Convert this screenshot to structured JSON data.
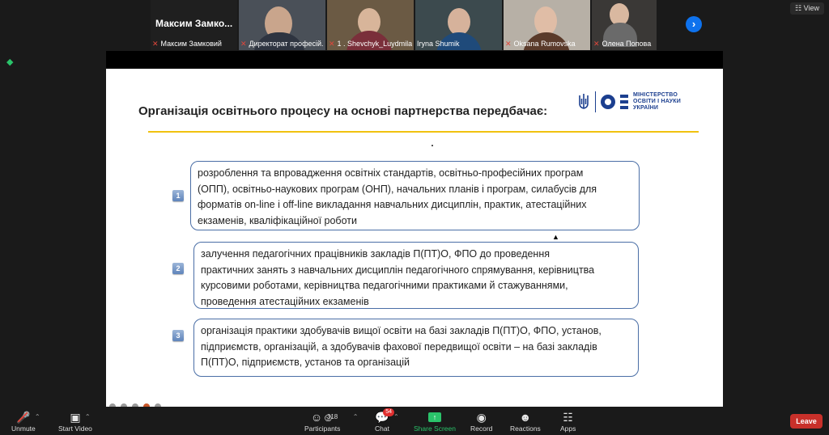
{
  "window": {
    "view_label": "View"
  },
  "gallery": {
    "tiles": [
      {
        "big_name": "Максим  Замко...",
        "name": "Максим Замковий"
      },
      {
        "name": "Директорат професій..."
      },
      {
        "name": "1 . Shevchyk_Luydmila"
      },
      {
        "name": "Iryna Shumik"
      },
      {
        "name": "Oksana Rumovska"
      },
      {
        "name": "Олена Попова"
      }
    ],
    "next_icon": "chevron-right-icon"
  },
  "slide": {
    "title": "Організація освітнього процесу на основі партнерства передбачає:",
    "logo_text": [
      "МІНІСТЕРСТВО",
      "ОСВІТИ І НАУКИ",
      "УКРАЇНИ"
    ],
    "accent_color": "#f0c20f",
    "items": [
      {
        "number": "1",
        "lines": [
          "розроблення та впровадження освітніх стандартів, освітньо-професійних програм",
          "(ОПП), освітньо-наукових програм (ОНП), начальних планів і програм, силабусів для",
          "форматів on-line і off-line викладання навчальних дисциплін, практик, атестаційних",
          "екзаменів, кваліфікаційної роботи"
        ]
      },
      {
        "number": "2",
        "lines": [
          "залучення педагогічних працівників закладів П(ПТ)О, ФПО до проведення",
          "практичних занять з навчальних дисциплін педагогічного спрямування, керівництва",
          "курсовими роботами, керівництва педагогічними практиками й стажуваннями,",
          "проведення атестаційних екзаменів"
        ]
      },
      {
        "number": "3",
        "lines": [
          "організація практики здобувачів вищої освіти на базі закладів П(ПТ)О, ФПО, установ,",
          "підприємств, організацій, а здобувачів фахової передвищої освіти – на базі закладів",
          "П(ПТ)О, підприємств, установ та організацій"
        ]
      }
    ]
  },
  "toolbar": {
    "unmute": "Unmute",
    "start_video": "Start Video",
    "participants": "Participants",
    "participants_count": "318",
    "chat": "Chat",
    "chat_badge": "54",
    "share_screen": "Share Screen",
    "record": "Record",
    "reactions": "Reactions",
    "apps": "Apps",
    "leave": "Leave"
  }
}
